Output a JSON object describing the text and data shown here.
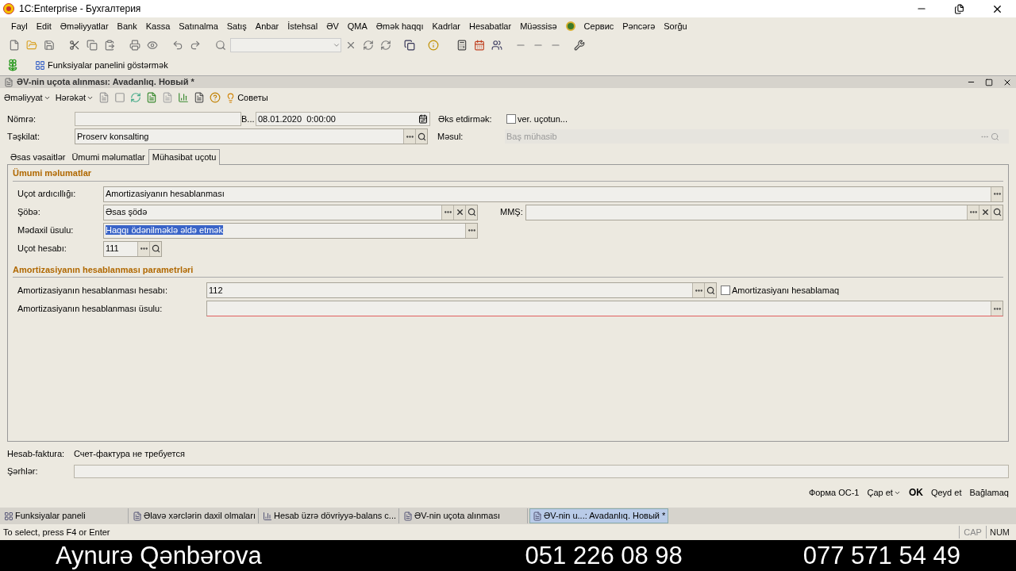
{
  "app": {
    "title": "1C:Enterprise - Бухгалтерия"
  },
  "menu": [
    {
      "label": "Fayl"
    },
    {
      "label": "Edit"
    },
    {
      "label": "Əməliyyatlar"
    },
    {
      "label": "Bank"
    },
    {
      "label": "Kassa"
    },
    {
      "label": "Satınalma"
    },
    {
      "label": "Satış"
    },
    {
      "label": "Anbar"
    },
    {
      "label": "İstehsal"
    },
    {
      "label": "ƏV"
    },
    {
      "label": "QMA"
    },
    {
      "label": "Əmək haqqı"
    },
    {
      "label": "Kadrlar"
    },
    {
      "label": "Hesabatlar"
    },
    {
      "label": "Müəssisə"
    },
    {
      "label": "Сервис"
    },
    {
      "label": "Pəncərə"
    },
    {
      "label": "Sorğu"
    }
  ],
  "panel_button": "Funksiyalar panelini göstərmək",
  "document": {
    "title": "ƏV-nin uçota alınması: Avadanlıq. Новый *",
    "actions": [
      {
        "label": "Əməliyyat",
        "kind": "menu"
      },
      {
        "label": "Hərəkət",
        "kind": "menu"
      },
      {
        "label": "Советы",
        "kind": "button"
      }
    ],
    "number_label": "Nömrə:",
    "date": {
      "label": "B...",
      "value": "08.01.2020  0:00:00"
    },
    "reflect": {
      "label": "Əks etdirmək:",
      "checkbox_label": "ver. uçotun...",
      "checked": false
    },
    "organization": {
      "label": "Təşkilat:",
      "value": "Proserv konsalting"
    },
    "responsible": {
      "label": "Məsul:",
      "value": "Baş mühasib",
      "disabled": true
    },
    "tabs": [
      {
        "label": "Əsas vəsaitlər",
        "selected": false
      },
      {
        "label": "Ümumi məlumatlar",
        "selected": false
      },
      {
        "label": "Mühasibat uçotu",
        "selected": true
      }
    ],
    "sections": [
      {
        "title": "Ümumi məlumatlar",
        "fields": [
          {
            "label": "Uçot ardıcıllığı:",
            "value": "Amortizasiyanın hesablanması",
            "buttons": [
              {
                "kind": "choose"
              }
            ]
          },
          {
            "label": "Şöbə:",
            "value": "Əsas şödə",
            "buttons": [
              {
                "kind": "choose"
              },
              {
                "kind": "clear"
              },
              {
                "kind": "search"
              }
            ]
          },
          {
            "label": "MMŞ:",
            "buttons": [
              {
                "kind": "choose"
              },
              {
                "kind": "clear"
              },
              {
                "kind": "search"
              }
            ]
          },
          {
            "label": "Mədaxil üsulu:",
            "value": "Haqqı ödənilməklə əldə etmək",
            "value_selected": true,
            "buttons": [
              {
                "kind": "choose"
              }
            ]
          },
          {
            "label": "Uçot hesabı:",
            "value": "111",
            "buttons": [
              {
                "kind": "choose"
              },
              {
                "kind": "search"
              }
            ]
          }
        ]
      },
      {
        "title": "Amortizasiyanın hesablanması parametrləri",
        "fields": [
          {
            "label": "Amortizasiyanın hesablanması hesabı:",
            "value": "112",
            "buttons": [
              {
                "kind": "choose"
              },
              {
                "kind": "search"
              }
            ],
            "checkbox_label": "Amortizasiyanı hesablamaq",
            "checked": false
          },
          {
            "label": "Amortizasiyanın hesablanması üsulu:",
            "invalid": true,
            "buttons": [
              {
                "kind": "choose"
              }
            ]
          }
        ]
      }
    ],
    "invoice": {
      "label": "Hesab-faktura:",
      "value": "Счет-фактура не требуется"
    },
    "comments_label": "Şərhlər:",
    "buttons": [
      {
        "label": "Форма ОС-1",
        "kind": "plain"
      },
      {
        "label": "Çap et",
        "kind": "menu"
      },
      {
        "label": "OK",
        "kind": "default"
      },
      {
        "label": "Qeyd et",
        "kind": "plain"
      },
      {
        "label": "Bağlamaq",
        "kind": "plain"
      }
    ]
  },
  "taskbar": [
    {
      "label": "Funksiyalar paneli",
      "kind": "panel",
      "selected": false
    },
    {
      "label": "Əlavə xərclərin daxil olmaları",
      "kind": "document",
      "selected": false
    },
    {
      "label": "Hesab üzrə dövriyyə-balans c...",
      "kind": "report",
      "selected": false
    },
    {
      "label": "ƏV-nin uçota alınması",
      "kind": "document",
      "selected": false
    },
    {
      "label": "ƏV-nin u...: Avadanlıq. Новый *",
      "kind": "document",
      "selected": true
    }
  ],
  "status": {
    "hint": "To select, press F4 or Enter",
    "indicators": [
      "CAP",
      "NUM"
    ]
  },
  "caption": {
    "name": "Aynurə Qənbərova",
    "phones": [
      "051 226 08 98",
      "077 571 54 49"
    ]
  }
}
